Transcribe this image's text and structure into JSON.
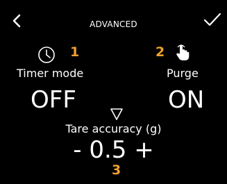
{
  "header": {
    "title": "ADVANCED",
    "back_icon": "chevron-left-icon",
    "confirm_icon": "checkmark-icon"
  },
  "timer": {
    "icon": "clock-icon",
    "badge": "1",
    "label": "Timer mode",
    "value": "OFF"
  },
  "purge": {
    "icon": "touch-hand-icon",
    "badge": "2",
    "label": "Purge",
    "value": "ON"
  },
  "tare": {
    "arrow_icon": "triangle-down-icon",
    "label": "Tare accuracy (g)",
    "decrement": "-",
    "value": "0.5",
    "increment": "+",
    "badge": "3"
  },
  "colors": {
    "background": "#000000",
    "text": "#ffffff",
    "badge": "#f0a030"
  }
}
